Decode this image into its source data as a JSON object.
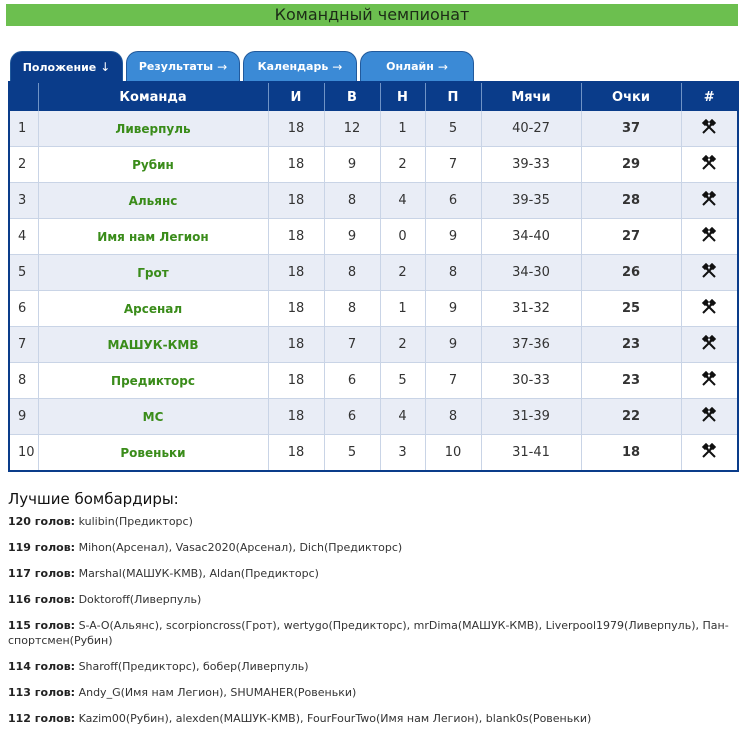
{
  "title": "Командный чемпионат",
  "tabs": [
    {
      "label": "Положение",
      "arrow": "↓"
    },
    {
      "label": "Результаты",
      "arrow": "→"
    },
    {
      "label": "Календарь",
      "arrow": "→"
    },
    {
      "label": "Онлайн",
      "arrow": "→"
    }
  ],
  "table": {
    "headers": {
      "team": "Команда",
      "played": "И",
      "won": "В",
      "drawn": "Н",
      "lost": "П",
      "goals": "Мячи",
      "points": "Очки",
      "action": "#"
    },
    "rows": [
      {
        "pos": "1",
        "team": "Ливерпуль",
        "played": "18",
        "won": "12",
        "drawn": "1",
        "lost": "5",
        "goals": "40-27",
        "points": "37"
      },
      {
        "pos": "2",
        "team": "Рубин",
        "played": "18",
        "won": "9",
        "drawn": "2",
        "lost": "7",
        "goals": "39-33",
        "points": "29"
      },
      {
        "pos": "3",
        "team": "Альянс",
        "played": "18",
        "won": "8",
        "drawn": "4",
        "lost": "6",
        "goals": "39-35",
        "points": "28"
      },
      {
        "pos": "4",
        "team": "Имя нам Легион",
        "played": "18",
        "won": "9",
        "drawn": "0",
        "lost": "9",
        "goals": "34-40",
        "points": "27"
      },
      {
        "pos": "5",
        "team": "Грот",
        "played": "18",
        "won": "8",
        "drawn": "2",
        "lost": "8",
        "goals": "34-30",
        "points": "26"
      },
      {
        "pos": "6",
        "team": "Арсенал",
        "played": "18",
        "won": "8",
        "drawn": "1",
        "lost": "9",
        "goals": "31-32",
        "points": "25"
      },
      {
        "pos": "7",
        "team": "МАШУК-КМВ",
        "played": "18",
        "won": "7",
        "drawn": "2",
        "lost": "9",
        "goals": "37-36",
        "points": "23"
      },
      {
        "pos": "8",
        "team": "Предикторс",
        "played": "18",
        "won": "6",
        "drawn": "5",
        "lost": "7",
        "goals": "30-33",
        "points": "23"
      },
      {
        "pos": "9",
        "team": "MC",
        "played": "18",
        "won": "6",
        "drawn": "4",
        "lost": "8",
        "goals": "31-39",
        "points": "22"
      },
      {
        "pos": "10",
        "team": "Ровеньки",
        "played": "18",
        "won": "5",
        "drawn": "3",
        "lost": "10",
        "goals": "31-41",
        "points": "18"
      }
    ],
    "action_icon": "hammer-pick-icon"
  },
  "scorers": {
    "heading": "Лучшие бомбардиры:",
    "lines": [
      {
        "goals": "120 голов:",
        "players": "kulibin(Предикторс)"
      },
      {
        "goals": "119 голов:",
        "players": "Mihon(Арсенал), Vasac2020(Арсенал), Dich(Предикторс)"
      },
      {
        "goals": "117 голов:",
        "players": "Marshal(МАШУК-КМВ), Aldan(Предикторс)"
      },
      {
        "goals": "116 голов:",
        "players": "Doktoroff(Ливерпуль)"
      },
      {
        "goals": "115 голов:",
        "players": "S-A-O(Альянс), scorpioncross(Грот), wertygo(Предикторс), mrDima(МАШУК-КМВ), Liverpool1979(Ливерпуль), Пан-спортсмен(Рубин)"
      },
      {
        "goals": "114 голов:",
        "players": "Sharoff(Предикторс), бобер(Ливерпуль)"
      },
      {
        "goals": "113 голов:",
        "players": "Andy_G(Имя нам Легион), SHUMAHER(Ровеньки)"
      },
      {
        "goals": "112 голов:",
        "players": "Kazim00(Рубин), alexden(МАШУК-КМВ), FourFourTwo(Имя нам Легион), blank0s(Ровеньки)"
      }
    ]
  }
}
